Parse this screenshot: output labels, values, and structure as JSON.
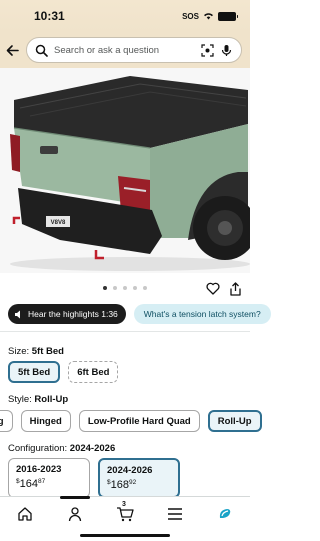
{
  "status_bar": {
    "time": "10:31",
    "sos": "SOS"
  },
  "search": {
    "placeholder": "Search or ask a question"
  },
  "product_image": {
    "plate_text": "V8V8"
  },
  "gallery": {
    "dot_count": 5,
    "active_index": 0
  },
  "highlights": {
    "audio_label": "Hear the highlights 1:36",
    "question_label": "What's a tension latch system?"
  },
  "size": {
    "label": "Size:",
    "value": "5ft Bed",
    "options": [
      "5ft Bed",
      "6ft Bed"
    ]
  },
  "style": {
    "label": "Style:",
    "value": "Roll-Up",
    "options": [
      "ng",
      "Hinged",
      "Low-Profile Hard Quad",
      "Roll-Up"
    ]
  },
  "configuration": {
    "label": "Configuration:",
    "value": "2024-2026",
    "options": [
      {
        "title": "2016-2023",
        "dollar": "$",
        "whole": "164",
        "cents": "87"
      },
      {
        "title": "2024-2026",
        "dollar": "$",
        "whole": "168",
        "cents": "92"
      }
    ]
  },
  "tab_bar": {
    "cart_count": "3"
  },
  "colors": {
    "accent": "#2f6f90",
    "header_bg": "#f0e3cb",
    "truck_green": "#8fad95"
  }
}
